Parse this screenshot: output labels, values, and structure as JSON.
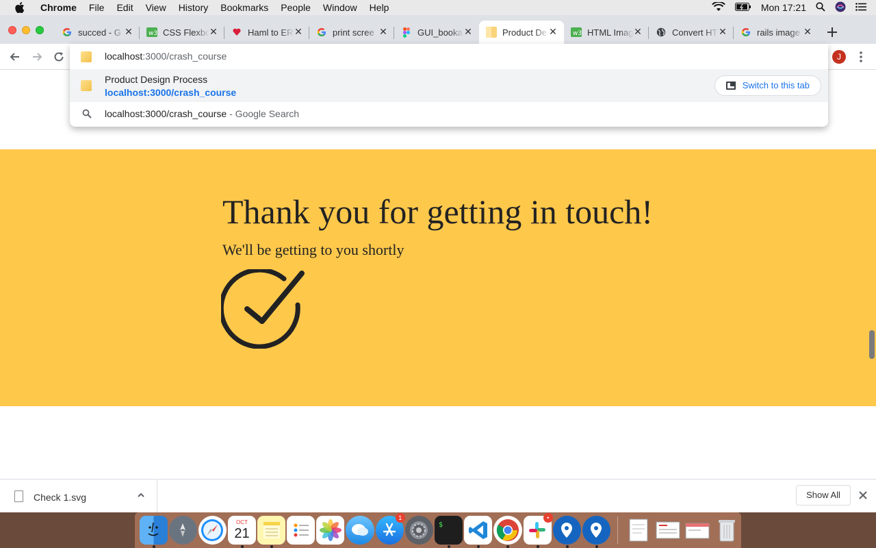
{
  "menubar": {
    "app_name": "Chrome",
    "items": [
      "File",
      "Edit",
      "View",
      "History",
      "Bookmarks",
      "People",
      "Window",
      "Help"
    ],
    "clock": "Mon 17:21"
  },
  "tabs": [
    {
      "label": "succed - G",
      "icon": "google-icon"
    },
    {
      "label": "CSS Flexbo",
      "icon": "w3schools-icon"
    },
    {
      "label": "Haml to ER",
      "icon": "heart-icon"
    },
    {
      "label": "print scree",
      "icon": "google-icon"
    },
    {
      "label": "GUI_booka",
      "icon": "figma-icon"
    },
    {
      "label": "Product De",
      "icon": "page-icon"
    },
    {
      "label": "HTML Imag",
      "icon": "w3schools-icon"
    },
    {
      "label": "Convert HT",
      "icon": "globe-icon"
    },
    {
      "label": "rails image",
      "icon": "google-icon"
    }
  ],
  "active_tab_index": 5,
  "omnibox": {
    "host": "localhost",
    "path": ":3000/crash_course",
    "suggestion_title": "Product Design Process",
    "suggestion_url": "localhost:3000/crash_course",
    "switch_label": "Switch to this tab",
    "search_query": "localhost:3000/crash_course",
    "search_suffix": " - Google Search"
  },
  "toolbar": {
    "profile_initial": "J"
  },
  "page": {
    "heading": "Thank you for getting in touch!",
    "subheading": "We'll be getting to you shortly",
    "banner_color": "#fec84b"
  },
  "downloads": {
    "file_name": "Check 1.svg",
    "show_all_label": "Show All"
  },
  "dock": {
    "appstore_badge": "1",
    "slack_badge": "•",
    "calendar_month": "OCT",
    "calendar_day": "21"
  }
}
